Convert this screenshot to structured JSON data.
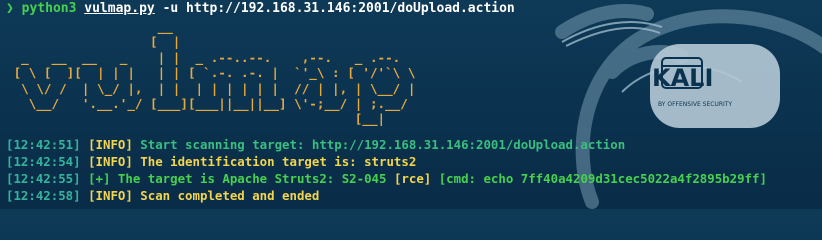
{
  "terminal": {
    "prompt_symbol": "❯",
    "program": "python3",
    "script": "vulmap.py",
    "arguments": "-u http://192.168.31.146:2001/doUpload.action"
  },
  "banner": {
    "ascii_art": "                    __\n                   [  |\n  _   __  __   _    | |  _ .--..--.    ,--.   _ .--.\n [ \\ [  ][  | | |   | | [ `.-. .-. |  `'_\\ : [ '/'`\\ \\\n  \\ \\/ /  | \\_/ |,  | |  | | | | | |  // | |, | \\__/ |\n   \\__/   '.__.'_/ [___][___||__||__] \\'-;__/ | ;.__/\n                                              [__|"
  },
  "log": [
    {
      "timestamp": "[12:42:51]",
      "tag": "[INFO]",
      "message": " Start scanning target: http://192.168.31.146:2001/doUpload.action"
    },
    {
      "timestamp": "[12:42:54]",
      "tag": "[INFO]",
      "message": " The identification target is: struts2"
    },
    {
      "timestamp": "[12:42:55]",
      "tag": "[+]",
      "message": " The target is Apache Struts2: S2-045",
      "rce": " [rce]",
      "cmd": " [cmd: echo 7ff40a4209d31cec5022a4f2895b29ff]"
    },
    {
      "timestamp": "[12:42:58]",
      "tag": "[INFO]",
      "message": " Scan completed and ended"
    }
  ],
  "wallpaper": {
    "logo_text": "KALI",
    "logo_subtext": "BY OFFENSIVE SECURITY",
    "colors": {
      "background": "#0b3350",
      "logo": "#b9cfdc",
      "timestamp": "#35b49c",
      "info": "#f3d54e",
      "success": "#47d14f",
      "banner": "#e8a93c"
    }
  }
}
